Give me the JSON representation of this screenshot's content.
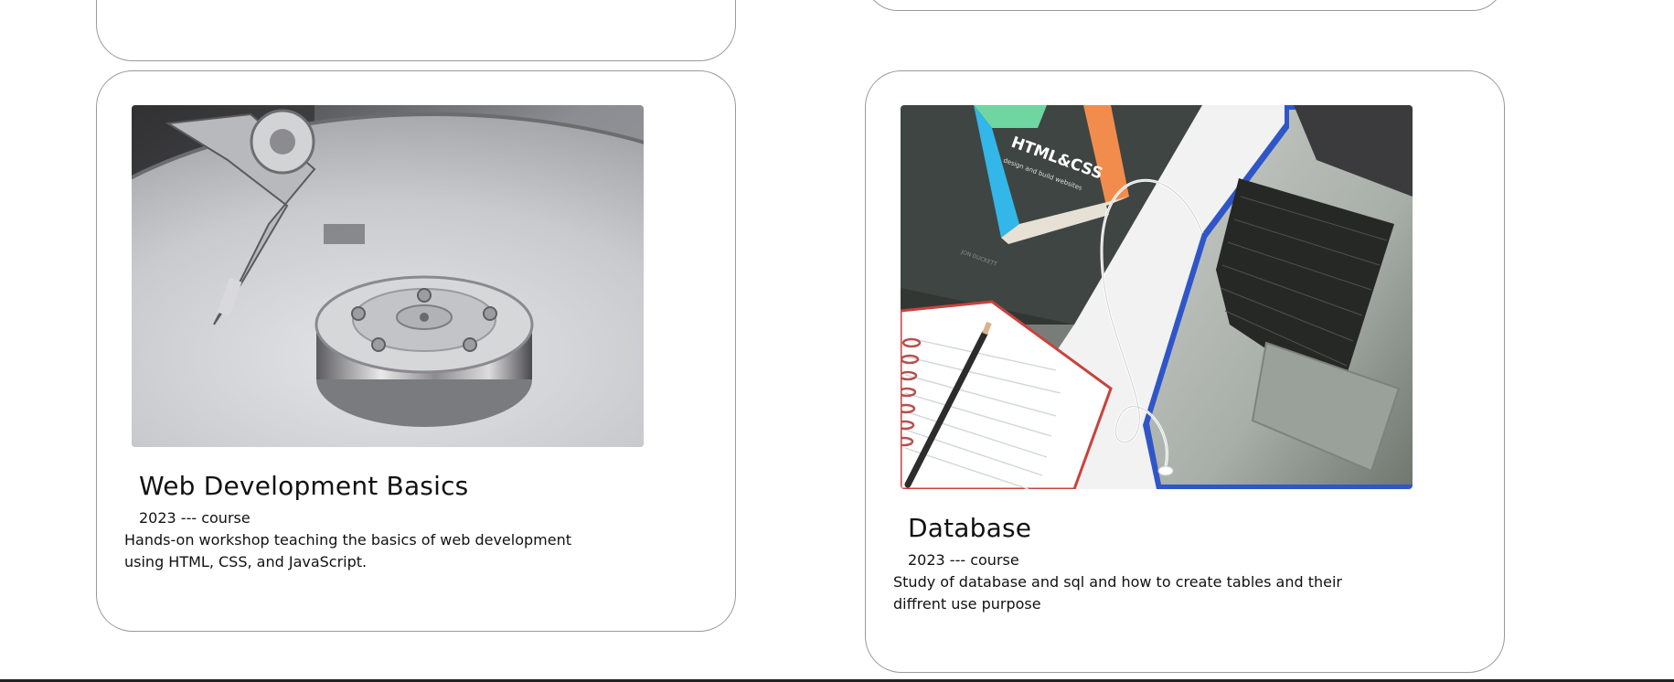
{
  "cards": [
    {
      "title": "Web Development Basics",
      "meta": "2023 --- course",
      "description": "Hands-on workshop teaching the basics of web development using HTML, CSS, and JavaScript.",
      "image_subject": "hard-disk-drive-photo"
    },
    {
      "title": "Database",
      "meta": "2023 --- course",
      "description": "Study of database and sql and how to create tables and their diffrent use purpose",
      "image_subject": "desk-with-book-notebook-laptop-photo",
      "image_text": {
        "book_title": "HTML&CSS",
        "book_subtitle": "design and build websites",
        "book_author": "JON DUCKETT"
      }
    }
  ],
  "colors": {
    "card_border": "#9a9a9a",
    "background": "#ffffff",
    "text": "#111111"
  }
}
